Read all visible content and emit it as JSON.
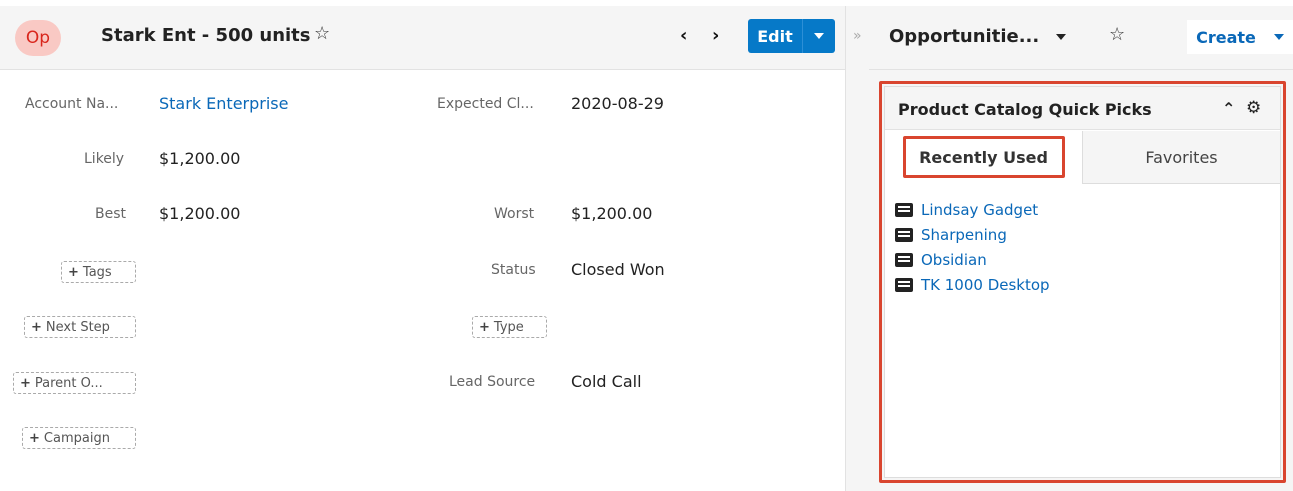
{
  "record": {
    "avatar": "Op",
    "title": "Stark Ent - 500 units",
    "edit_label": "Edit"
  },
  "fields": {
    "account_name_label": "Account Na...",
    "account_name_value": "Stark Enterprise",
    "expected_close_label": "Expected Cl...",
    "expected_close_value": "2020-08-29",
    "likely_label": "Likely",
    "likely_value": "$1,200.00",
    "best_label": "Best",
    "best_value": "$1,200.00",
    "worst_label": "Worst",
    "worst_value": "$1,200.00",
    "status_label": "Status",
    "status_value": "Closed Won",
    "lead_source_label": "Lead Source",
    "lead_source_value": "Cold Call"
  },
  "add_buttons": {
    "tags": "Tags",
    "next_step": "Next Step",
    "type": "Type",
    "parent": "Parent O...",
    "campaign": "Campaign"
  },
  "sidebar": {
    "module": "Opportunitie...",
    "create_label": "Create"
  },
  "dashlet": {
    "title": "Product Catalog Quick Picks",
    "tabs": {
      "recent": "Recently Used",
      "favorites": "Favorites"
    },
    "items": [
      "Lindsay Gadget",
      "Sharpening",
      "Obsidian",
      "TK 1000 Desktop"
    ]
  },
  "colors": {
    "accent": "#0679c8",
    "link": "#0a68b8",
    "highlight": "#d9452f",
    "avatar_bg": "#f9c9c4"
  }
}
